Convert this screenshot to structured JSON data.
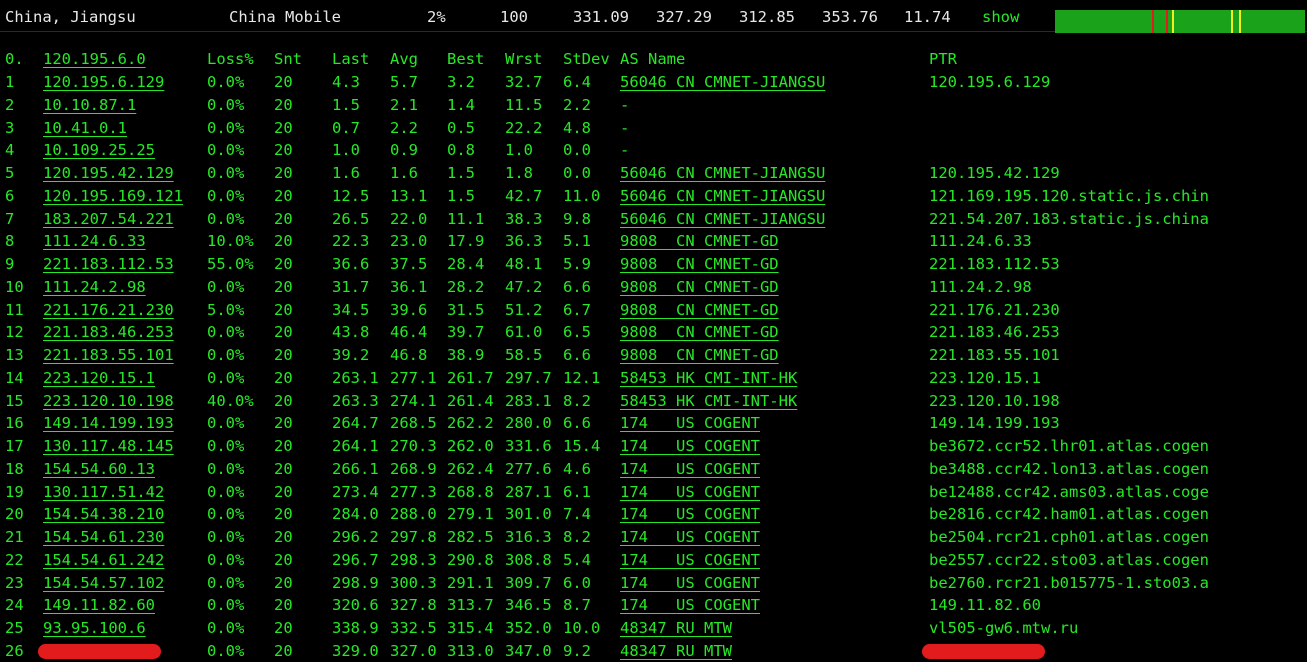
{
  "header": {
    "location": "China, Jiangsu",
    "isp": "China Mobile",
    "loss": "2%",
    "sent": "100",
    "last": "331.09",
    "avg": "327.29",
    "best": "312.85",
    "worst": "353.76",
    "stdev": "11.74",
    "show_label": "show"
  },
  "colors": {
    "background": "#000000",
    "text_green": "#27e827",
    "header_text": "#e8e8e8",
    "graph_green": "#1aa31a",
    "graph_red": "#e21c1c",
    "graph_yellow": "#f0f020",
    "redaction": "#e21c1c"
  },
  "columns": {
    "hop": "0.",
    "host": "120.195.6.0",
    "loss": "Loss%",
    "snt": "Snt",
    "last": "Last",
    "avg": "Avg",
    "best": "Best",
    "wrst": "Wrst",
    "stdev": "StDev",
    "asn": "AS Name",
    "ptr": "PTR"
  },
  "rows": [
    {
      "hop": "1",
      "host": "120.195.6.129",
      "loss": "0.0%",
      "snt": "20",
      "last": "4.3",
      "avg": "5.7",
      "best": "3.2",
      "wrst": "32.7",
      "stdev": "6.4",
      "asn": "56046 CN CMNET-JIANGSU",
      "ptr": "120.195.6.129"
    },
    {
      "hop": "2",
      "host": "10.10.87.1",
      "loss": "0.0%",
      "snt": "20",
      "last": "1.5",
      "avg": "2.1",
      "best": "1.4",
      "wrst": "11.5",
      "stdev": "2.2",
      "asn": "-",
      "ptr": ""
    },
    {
      "hop": "3",
      "host": "10.41.0.1",
      "loss": "0.0%",
      "snt": "20",
      "last": "0.7",
      "avg": "2.2",
      "best": "0.5",
      "wrst": "22.2",
      "stdev": "4.8",
      "asn": "-",
      "ptr": ""
    },
    {
      "hop": "4",
      "host": "10.109.25.25",
      "loss": "0.0%",
      "snt": "20",
      "last": "1.0",
      "avg": "0.9",
      "best": "0.8",
      "wrst": "1.0",
      "stdev": "0.0",
      "asn": "-",
      "ptr": ""
    },
    {
      "hop": "5",
      "host": "120.195.42.129",
      "loss": "0.0%",
      "snt": "20",
      "last": "1.6",
      "avg": "1.6",
      "best": "1.5",
      "wrst": "1.8",
      "stdev": "0.0",
      "asn": "56046 CN CMNET-JIANGSU",
      "ptr": "120.195.42.129"
    },
    {
      "hop": "6",
      "host": "120.195.169.121",
      "loss": "0.0%",
      "snt": "20",
      "last": "12.5",
      "avg": "13.1",
      "best": "1.5",
      "wrst": "42.7",
      "stdev": "11.0",
      "asn": "56046 CN CMNET-JIANGSU",
      "ptr": "121.169.195.120.static.js.chin"
    },
    {
      "hop": "7",
      "host": "183.207.54.221",
      "loss": "0.0%",
      "snt": "20",
      "last": "26.5",
      "avg": "22.0",
      "best": "11.1",
      "wrst": "38.3",
      "stdev": "9.8",
      "asn": "56046 CN CMNET-JIANGSU",
      "ptr": "221.54.207.183.static.js.china"
    },
    {
      "hop": "8",
      "host": "111.24.6.33",
      "loss": "10.0%",
      "snt": "20",
      "last": "22.3",
      "avg": "23.0",
      "best": "17.9",
      "wrst": "36.3",
      "stdev": "5.1",
      "asn": "9808  CN CMNET-GD",
      "ptr": "111.24.6.33"
    },
    {
      "hop": "9",
      "host": "221.183.112.53",
      "loss": "55.0%",
      "snt": "20",
      "last": "36.6",
      "avg": "37.5",
      "best": "28.4",
      "wrst": "48.1",
      "stdev": "5.9",
      "asn": "9808  CN CMNET-GD",
      "ptr": "221.183.112.53"
    },
    {
      "hop": "10",
      "host": "111.24.2.98",
      "loss": "0.0%",
      "snt": "20",
      "last": "31.7",
      "avg": "36.1",
      "best": "28.2",
      "wrst": "47.2",
      "stdev": "6.6",
      "asn": "9808  CN CMNET-GD",
      "ptr": "111.24.2.98"
    },
    {
      "hop": "11",
      "host": "221.176.21.230",
      "loss": "5.0%",
      "snt": "20",
      "last": "34.5",
      "avg": "39.6",
      "best": "31.5",
      "wrst": "51.2",
      "stdev": "6.7",
      "asn": "9808  CN CMNET-GD",
      "ptr": "221.176.21.230"
    },
    {
      "hop": "12",
      "host": "221.183.46.253",
      "loss": "0.0%",
      "snt": "20",
      "last": "43.8",
      "avg": "46.4",
      "best": "39.7",
      "wrst": "61.0",
      "stdev": "6.5",
      "asn": "9808  CN CMNET-GD",
      "ptr": "221.183.46.253"
    },
    {
      "hop": "13",
      "host": "221.183.55.101",
      "loss": "0.0%",
      "snt": "20",
      "last": "39.2",
      "avg": "46.8",
      "best": "38.9",
      "wrst": "58.5",
      "stdev": "6.6",
      "asn": "9808  CN CMNET-GD",
      "ptr": "221.183.55.101"
    },
    {
      "hop": "14",
      "host": "223.120.15.1",
      "loss": "0.0%",
      "snt": "20",
      "last": "263.1",
      "avg": "277.1",
      "best": "261.7",
      "wrst": "297.7",
      "stdev": "12.1",
      "asn": "58453 HK CMI-INT-HK",
      "ptr": "223.120.15.1"
    },
    {
      "hop": "15",
      "host": "223.120.10.198",
      "loss": "40.0%",
      "snt": "20",
      "last": "263.3",
      "avg": "274.1",
      "best": "261.4",
      "wrst": "283.1",
      "stdev": "8.2",
      "asn": "58453 HK CMI-INT-HK",
      "ptr": "223.120.10.198"
    },
    {
      "hop": "16",
      "host": "149.14.199.193",
      "loss": "0.0%",
      "snt": "20",
      "last": "264.7",
      "avg": "268.5",
      "best": "262.2",
      "wrst": "280.0",
      "stdev": "6.6",
      "asn": "174   US COGENT",
      "ptr": "149.14.199.193"
    },
    {
      "hop": "17",
      "host": "130.117.48.145",
      "loss": "0.0%",
      "snt": "20",
      "last": "264.1",
      "avg": "270.3",
      "best": "262.0",
      "wrst": "331.6",
      "stdev": "15.4",
      "asn": "174   US COGENT",
      "ptr": "be3672.ccr52.lhr01.atlas.cogen"
    },
    {
      "hop": "18",
      "host": "154.54.60.13",
      "loss": "0.0%",
      "snt": "20",
      "last": "266.1",
      "avg": "268.9",
      "best": "262.4",
      "wrst": "277.6",
      "stdev": "4.6",
      "asn": "174   US COGENT",
      "ptr": "be3488.ccr42.lon13.atlas.cogen"
    },
    {
      "hop": "19",
      "host": "130.117.51.42",
      "loss": "0.0%",
      "snt": "20",
      "last": "273.4",
      "avg": "277.3",
      "best": "268.8",
      "wrst": "287.1",
      "stdev": "6.1",
      "asn": "174   US COGENT",
      "ptr": "be12488.ccr42.ams03.atlas.coge"
    },
    {
      "hop": "20",
      "host": "154.54.38.210",
      "loss": "0.0%",
      "snt": "20",
      "last": "284.0",
      "avg": "288.0",
      "best": "279.1",
      "wrst": "301.0",
      "stdev": "7.4",
      "asn": "174   US COGENT",
      "ptr": "be2816.ccr42.ham01.atlas.cogen"
    },
    {
      "hop": "21",
      "host": "154.54.61.230",
      "loss": "0.0%",
      "snt": "20",
      "last": "296.2",
      "avg": "297.8",
      "best": "282.5",
      "wrst": "316.3",
      "stdev": "8.2",
      "asn": "174   US COGENT",
      "ptr": "be2504.rcr21.cph01.atlas.cogen"
    },
    {
      "hop": "22",
      "host": "154.54.61.242",
      "loss": "0.0%",
      "snt": "20",
      "last": "296.7",
      "avg": "298.3",
      "best": "290.8",
      "wrst": "308.8",
      "stdev": "5.4",
      "asn": "174   US COGENT",
      "ptr": "be2557.ccr22.sto03.atlas.cogen"
    },
    {
      "hop": "23",
      "host": "154.54.57.102",
      "loss": "0.0%",
      "snt": "20",
      "last": "298.9",
      "avg": "300.3",
      "best": "291.1",
      "wrst": "309.7",
      "stdev": "6.0",
      "asn": "174   US COGENT",
      "ptr": "be2760.rcr21.b015775-1.sto03.a"
    },
    {
      "hop": "24",
      "host": "149.11.82.60",
      "loss": "0.0%",
      "snt": "20",
      "last": "320.6",
      "avg": "327.8",
      "best": "313.7",
      "wrst": "346.5",
      "stdev": "8.7",
      "asn": "174   US COGENT",
      "ptr": "149.11.82.60"
    },
    {
      "hop": "25",
      "host": "93.95.100.6",
      "loss": "0.0%",
      "snt": "20",
      "last": "338.9",
      "avg": "332.5",
      "best": "315.4",
      "wrst": "352.0",
      "stdev": "10.0",
      "asn": "48347 RU MTW",
      "ptr": "vl505-gw6.mtw.ru"
    },
    {
      "hop": "26",
      "host": "",
      "loss": "0.0%",
      "snt": "20",
      "last": "329.0",
      "avg": "327.0",
      "best": "313.0",
      "wrst": "347.0",
      "stdev": "9.2",
      "asn": "48347 RU MTW",
      "ptr": "",
      "redacted": true
    }
  ]
}
